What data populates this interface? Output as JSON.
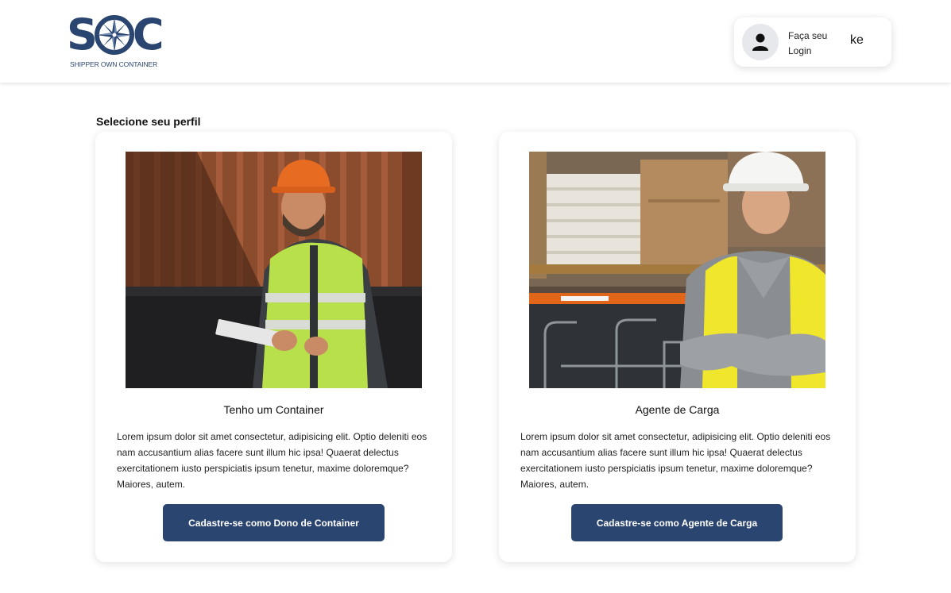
{
  "header": {
    "logo": {
      "letters": [
        "S",
        "C"
      ],
      "tagline": "SHIPPER OWN CONTAINER",
      "color": "#2b4571"
    },
    "login": {
      "line1": "Faça seu",
      "line2": "Login",
      "username": "ke",
      "icon": "user-icon"
    }
  },
  "main": {
    "section_title": "Selecione seu perfil",
    "cards": [
      {
        "image": "container-owner-photo",
        "title": "Tenho um Container",
        "description": "Lorem ipsum dolor sit amet consectetur, adipisicing elit. Optio deleniti eos nam accusantium alias facere sunt illum hic ipsa! Quaerat delectus exercitationem iusto perspiciatis ipsum tenetur, maxime doloremque? Maiores, autem.",
        "button": "Cadastre-se como Dono de Container"
      },
      {
        "image": "cargo-agent-photo",
        "title": "Agente de Carga",
        "description": "Lorem ipsum dolor sit amet consectetur, adipisicing elit. Optio deleniti eos nam accusantium alias facere sunt illum hic ipsa! Quaerat delectus exercitationem iusto perspiciatis ipsum tenetur, maxime doloremque? Maiores, autem.",
        "button": "Cadastre-se como Agente de Carga"
      }
    ]
  },
  "colors": {
    "primary": "#2b4571",
    "hi_vis_green": "#b8e04a",
    "hi_vis_yellow": "#f0e62c",
    "helmet_orange": "#e86b22",
    "container_rust": "#9c5634"
  }
}
